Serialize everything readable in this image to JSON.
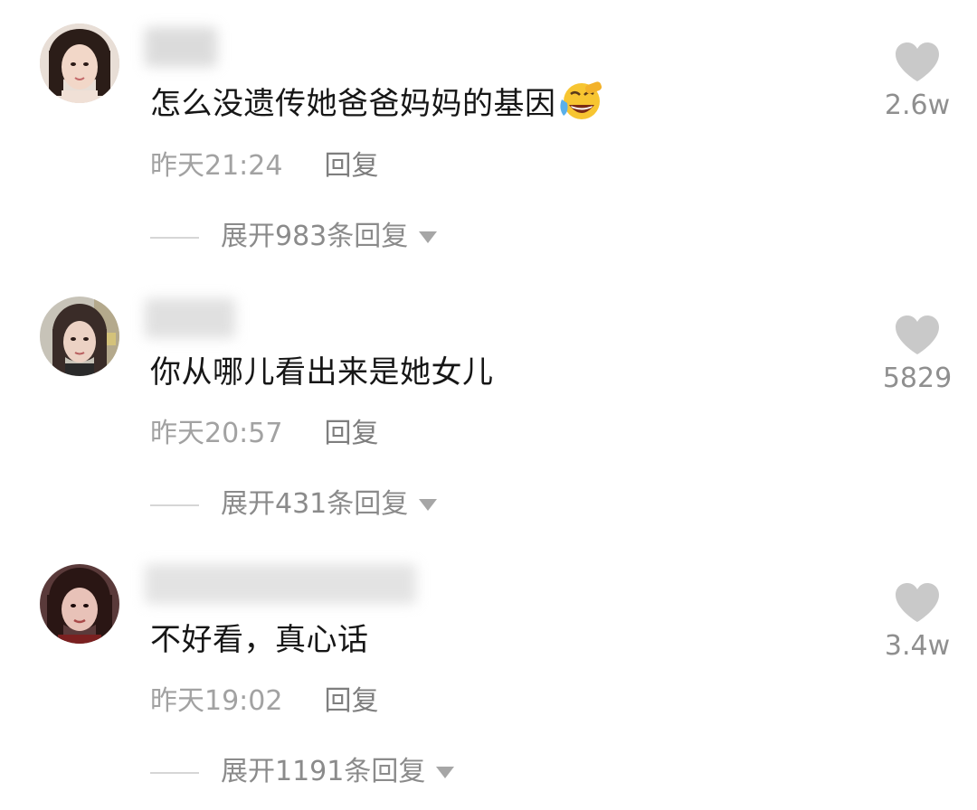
{
  "comments": [
    {
      "text": "怎么没遗传她爸爸妈妈的基因",
      "emoji": "face-with-tears-of-joy-icon",
      "time": "昨天21:24",
      "reply_label": "回复",
      "expand_label": "展开983条回复",
      "likes": "2.6w"
    },
    {
      "text": "你从哪儿看出来是她女儿",
      "time": "昨天20:57",
      "reply_label": "回复",
      "expand_label": "展开431条回复",
      "likes": "5829"
    },
    {
      "text": "不好看，真心话",
      "time": "昨天19:02",
      "reply_label": "回复",
      "expand_label": "展开1191条回复",
      "likes": "3.4w"
    }
  ],
  "colors": {
    "text": "#161616",
    "meta": "#a2a2a2",
    "like_icon": "#c9c9c9",
    "expand_caret": "#a6a6a6"
  }
}
